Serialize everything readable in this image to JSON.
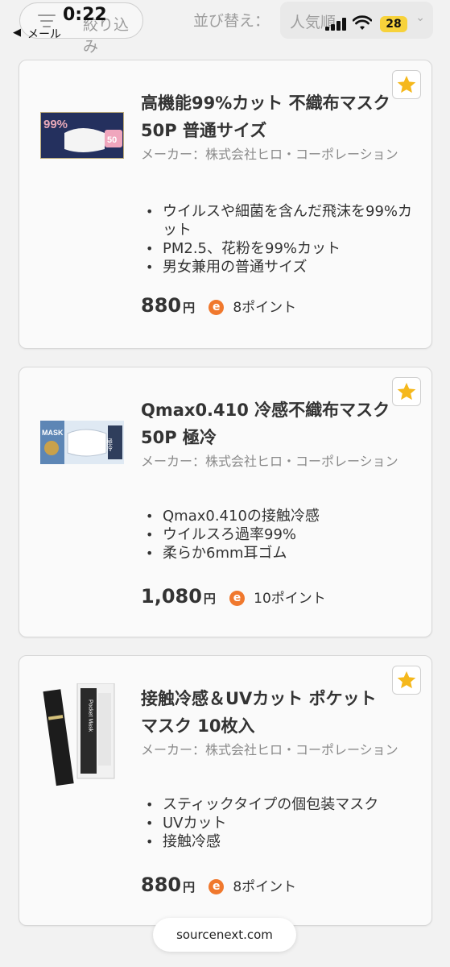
{
  "status_bar": {
    "time": "0:22",
    "back_label": "メール",
    "battery": "28"
  },
  "toolbar": {
    "filter_label": "絞り込み",
    "sort_label": "並び替え：",
    "sort_value": "人気順"
  },
  "products": [
    {
      "title": "高機能99%カット 不織布マスク 50P 普通サイズ",
      "maker": "メーカー：株式会社ヒロ・コーポレーション",
      "features": [
        "ウイルスや細菌を含んだ飛沫を99%カット",
        "PM2.5、花粉を99%カット",
        "男女兼用の普通サイズ"
      ],
      "price": "880",
      "yen": "円",
      "points_icon": "e",
      "points": "8ポイント",
      "thumb_text": "99%",
      "thumb_badge": "50"
    },
    {
      "title": "Qmax0.410 冷感不織布マスク 50P 極冷",
      "maker": "メーカー：株式会社ヒロ・コーポレーション",
      "features": [
        "Qmax0.410の接触冷感",
        "ウイルスろ過率99%",
        "柔らか6mm耳ゴム"
      ],
      "price": "1,080",
      "yen": "円",
      "points_icon": "e",
      "points": "10ポイント",
      "thumb_text": "MASK",
      "thumb_badge": "極冷"
    },
    {
      "title": "接触冷感＆UVカット ポケットマスク 10枚入",
      "maker": "メーカー：株式会社ヒロ・コーポレーション",
      "features": [
        "スティックタイプの個包装マスク",
        "UVカット",
        "接触冷感"
      ],
      "price": "880",
      "yen": "円",
      "points_icon": "e",
      "points": "8ポイント",
      "thumb_text": "Pocket Mask"
    }
  ],
  "footer": {
    "url": "sourcenext.com"
  },
  "colors": {
    "accent_star": "#f5b81c",
    "points_badge": "#f0782d",
    "card_bg": "#fafafa",
    "page_bg": "#f2f2f2"
  },
  "icons": [
    "filter-icon",
    "chevron-down-icon",
    "star-icon",
    "points-e-icon",
    "signal-icon",
    "wifi-icon",
    "battery-icon",
    "back-arrow-icon"
  ]
}
